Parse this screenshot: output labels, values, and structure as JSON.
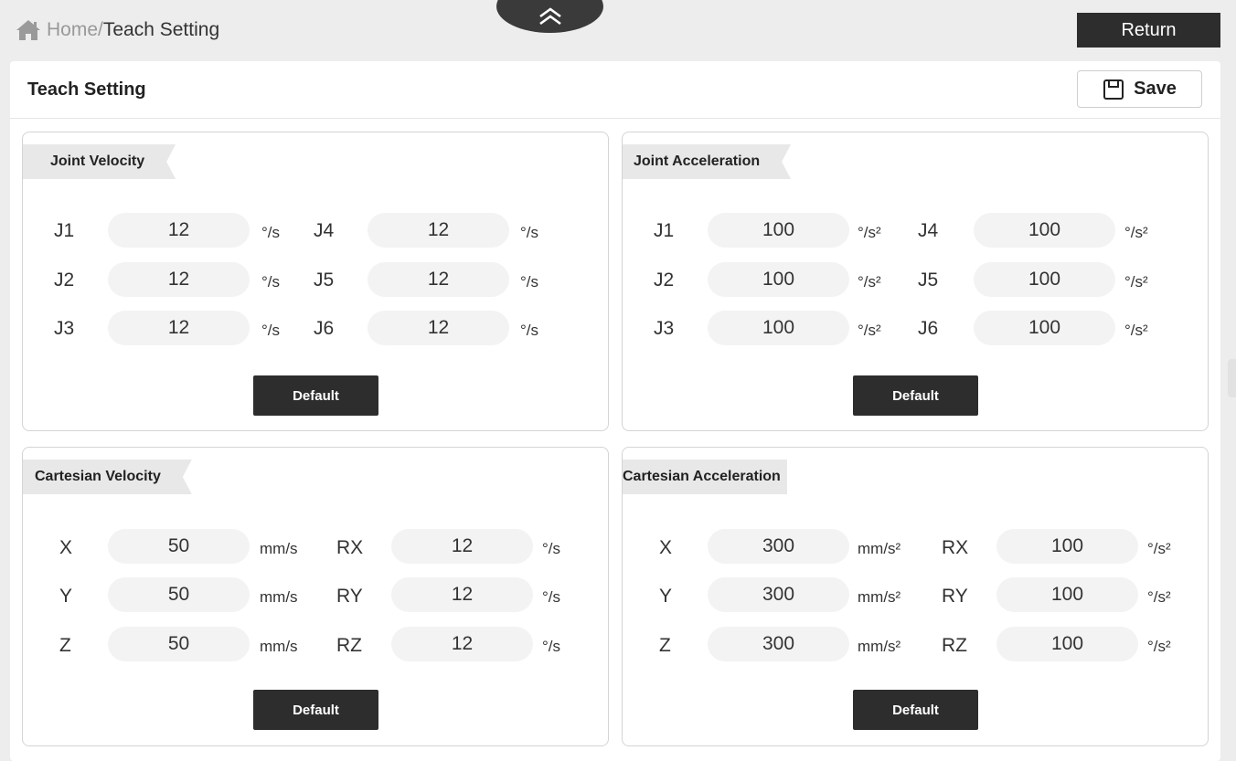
{
  "breadcrumb": {
    "home": "Home",
    "separator": "/",
    "current": "Teach Setting"
  },
  "header": {
    "return_label": "Return"
  },
  "page": {
    "title": "Teach Setting",
    "save_label": "Save"
  },
  "panels": {
    "joint_velocity": {
      "title": "Joint Velocity",
      "fields": [
        {
          "label": "J1",
          "value": "12",
          "unit": "°/s"
        },
        {
          "label": "J2",
          "value": "12",
          "unit": "°/s"
        },
        {
          "label": "J3",
          "value": "12",
          "unit": "°/s"
        },
        {
          "label": "J4",
          "value": "12",
          "unit": "°/s"
        },
        {
          "label": "J5",
          "value": "12",
          "unit": "°/s"
        },
        {
          "label": "J6",
          "value": "12",
          "unit": "°/s"
        }
      ],
      "default_label": "Default"
    },
    "joint_acceleration": {
      "title": "Joint Acceleration",
      "fields": [
        {
          "label": "J1",
          "value": "100",
          "unit": "°/s²"
        },
        {
          "label": "J2",
          "value": "100",
          "unit": "°/s²"
        },
        {
          "label": "J3",
          "value": "100",
          "unit": "°/s²"
        },
        {
          "label": "J4",
          "value": "100",
          "unit": "°/s²"
        },
        {
          "label": "J5",
          "value": "100",
          "unit": "°/s²"
        },
        {
          "label": "J6",
          "value": "100",
          "unit": "°/s²"
        }
      ],
      "default_label": "Default"
    },
    "cartesian_velocity": {
      "title": "Cartesian Velocity",
      "fields": [
        {
          "label": "X",
          "value": "50",
          "unit": "mm/s"
        },
        {
          "label": "Y",
          "value": "50",
          "unit": "mm/s"
        },
        {
          "label": "Z",
          "value": "50",
          "unit": "mm/s"
        },
        {
          "label": "RX",
          "value": "12",
          "unit": "°/s"
        },
        {
          "label": "RY",
          "value": "12",
          "unit": "°/s"
        },
        {
          "label": "RZ",
          "value": "12",
          "unit": "°/s"
        }
      ],
      "default_label": "Default"
    },
    "cartesian_acceleration": {
      "title": "Cartesian Acceleration",
      "fields": [
        {
          "label": "X",
          "value": "300",
          "unit": "mm/s²"
        },
        {
          "label": "Y",
          "value": "300",
          "unit": "mm/s²"
        },
        {
          "label": "Z",
          "value": "300",
          "unit": "mm/s²"
        },
        {
          "label": "RX",
          "value": "100",
          "unit": "°/s²"
        },
        {
          "label": "RY",
          "value": "100",
          "unit": "°/s²"
        },
        {
          "label": "RZ",
          "value": "100",
          "unit": "°/s²"
        }
      ],
      "default_label": "Default"
    }
  },
  "icons": {
    "home": "home-icon",
    "collapse": "chevron-double-up-icon",
    "save": "save-icon"
  },
  "colors": {
    "background": "#ededed",
    "panel": "#ffffff",
    "input_fill": "#f3f3f3",
    "button_dark": "#2d2d2d",
    "tab_fill": "#e8e8e8"
  }
}
